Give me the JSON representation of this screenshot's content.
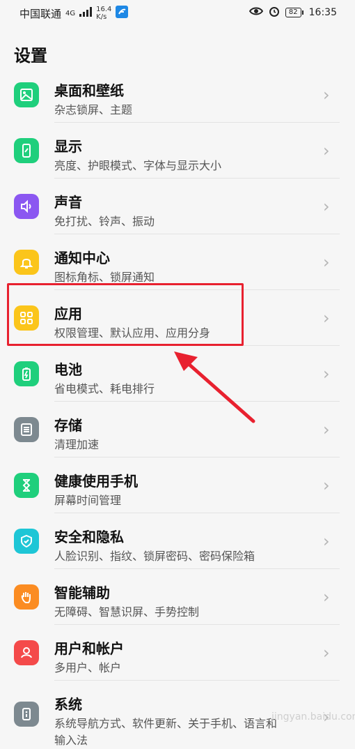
{
  "status": {
    "carrier": "中国联通",
    "network": "4G",
    "speed_top": "16.4",
    "speed_bottom": "K/s",
    "battery": "82",
    "time": "16:35",
    "icons": [
      "signal-icon",
      "app-notification-icon",
      "eye-icon",
      "alarm-icon",
      "battery-icon"
    ]
  },
  "page": {
    "title": "设置"
  },
  "items": [
    {
      "title": "桌面和壁纸",
      "subtitle": "杂志锁屏、主题",
      "icon": "wallpaper-icon",
      "color": "#1fcf7c"
    },
    {
      "title": "显示",
      "subtitle": "亮度、护眼模式、字体与显示大小",
      "icon": "display-icon",
      "color": "#1fcf7c"
    },
    {
      "title": "声音",
      "subtitle": "免打扰、铃声、振动",
      "icon": "sound-icon",
      "color": "#8b57f1"
    },
    {
      "title": "通知中心",
      "subtitle": "图标角标、锁屏通知",
      "icon": "bell-icon",
      "color": "#fbc51b"
    },
    {
      "title": "应用",
      "subtitle": "权限管理、默认应用、应用分身",
      "icon": "apps-icon",
      "color": "#fbc51b"
    },
    {
      "title": "电池",
      "subtitle": "省电模式、耗电排行",
      "icon": "battery-icon",
      "color": "#1fcf7c"
    },
    {
      "title": "存储",
      "subtitle": "清理加速",
      "icon": "storage-icon",
      "color": "#7d8990"
    },
    {
      "title": "健康使用手机",
      "subtitle": "屏幕时间管理",
      "icon": "hourglass-icon",
      "color": "#1fcf7c"
    },
    {
      "title": "安全和隐私",
      "subtitle": "人脸识别、指纹、锁屏密码、密码保险箱",
      "icon": "shield-icon",
      "color": "#1ec6d6"
    },
    {
      "title": "智能辅助",
      "subtitle": "无障碍、智慧识屏、手势控制",
      "icon": "hand-icon",
      "color": "#fb8c22"
    },
    {
      "title": "用户和帐户",
      "subtitle": "多用户、帐户",
      "icon": "user-icon",
      "color": "#f44a4a"
    },
    {
      "title": "系统",
      "subtitle": "系统导航方式、软件更新、关于手机、语言和",
      "subtitle2": "输入法",
      "icon": "system-info-icon",
      "color": "#7d8990"
    }
  ],
  "highlight": {
    "target": "应用"
  },
  "watermark": "jingyan.baidu.com"
}
